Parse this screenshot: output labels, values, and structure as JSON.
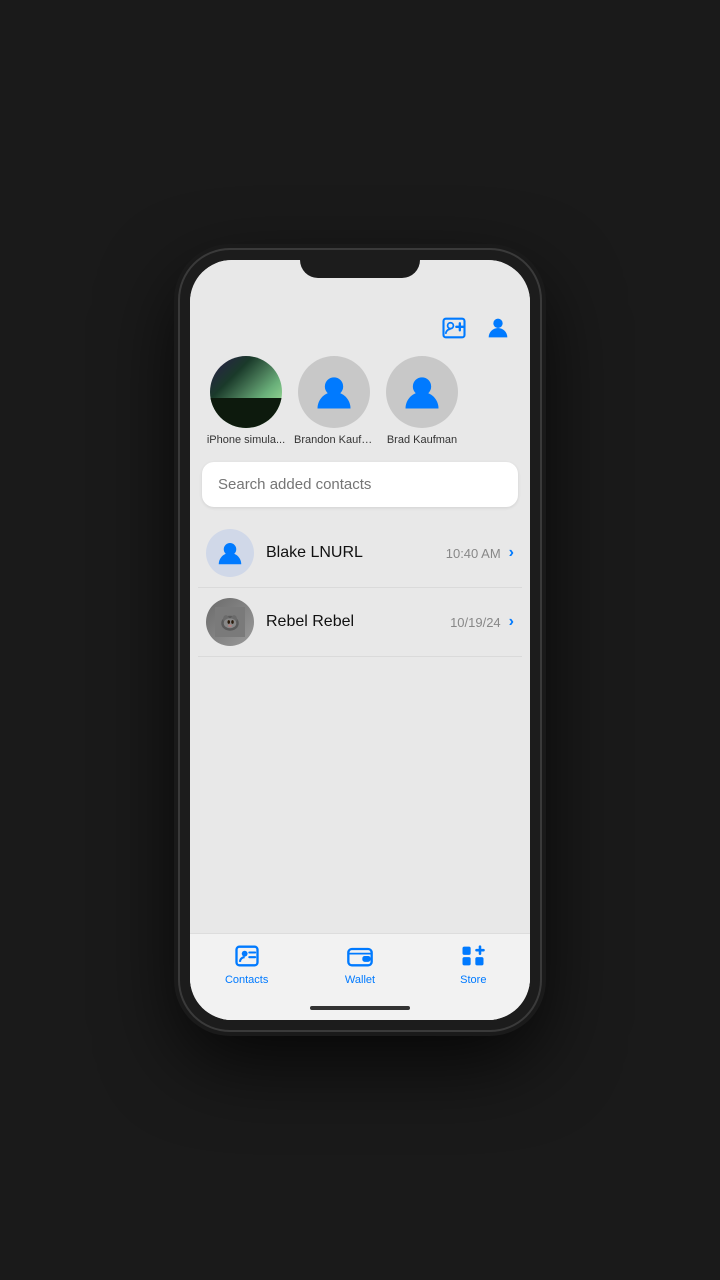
{
  "header": {
    "add_contact_icon": "add-contact-icon",
    "profile_icon": "profile-icon"
  },
  "featured_contacts": [
    {
      "id": "iphone-sim",
      "name": "iPhone simula...",
      "type": "aurora"
    },
    {
      "id": "brandon",
      "name": "Brandon Kaufm...",
      "type": "user"
    },
    {
      "id": "brad",
      "name": "Brad Kaufman",
      "type": "user"
    }
  ],
  "search": {
    "placeholder": "Search added contacts"
  },
  "contact_list": [
    {
      "id": "blake",
      "name": "Blake LNURL",
      "time": "10:40 AM",
      "type": "user"
    },
    {
      "id": "rebel",
      "name": "Rebel Rebel",
      "time": "10/19/24",
      "type": "photo"
    }
  ],
  "tab_bar": {
    "tabs": [
      {
        "id": "contacts",
        "label": "Contacts",
        "active": true
      },
      {
        "id": "wallet",
        "label": "Wallet",
        "active": false
      },
      {
        "id": "store",
        "label": "Store",
        "active": false
      }
    ]
  }
}
